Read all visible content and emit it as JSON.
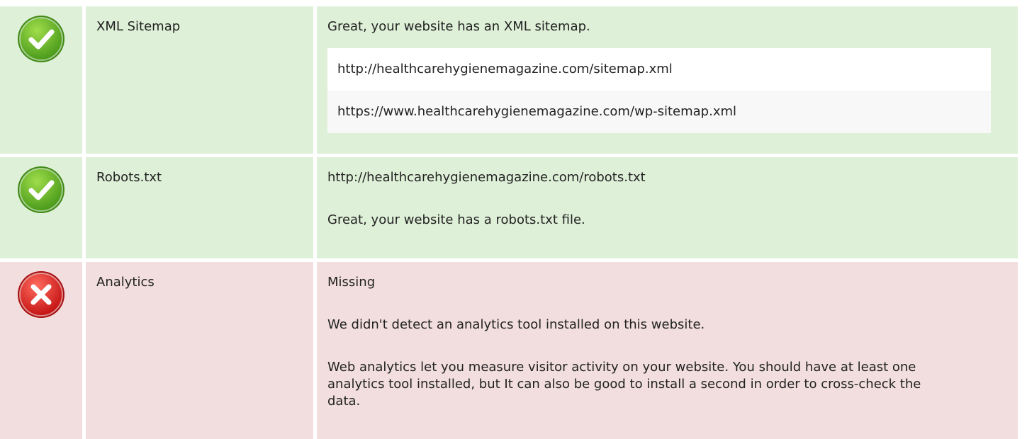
{
  "colors": {
    "pass_bg": "#dff0d8",
    "fail_bg": "#f2dede",
    "pass_icon": "#6dbb2c",
    "fail_icon": "#e02a2a"
  },
  "sitemap": {
    "status_icon": "check-circle-icon",
    "name": "XML Sitemap",
    "message": "Great, your website has an XML sitemap.",
    "urls": [
      "http://healthcarehygienemagazine.com/sitemap.xml",
      "https://www.healthcarehygienemagazine.com/wp-sitemap.xml"
    ]
  },
  "robots": {
    "status_icon": "check-circle-icon",
    "name": "Robots.txt",
    "url": "http://healthcarehygienemagazine.com/robots.txt",
    "message": "Great, your website has a robots.txt file."
  },
  "analytics": {
    "status_icon": "x-circle-icon",
    "name": "Analytics",
    "status": "Missing",
    "message": "We didn't detect an analytics tool installed on this website.",
    "description": "Web analytics let you measure visitor activity on your website. You should have at least one analytics tool installed, but It can also be good to install a second in order to cross-check the data."
  }
}
